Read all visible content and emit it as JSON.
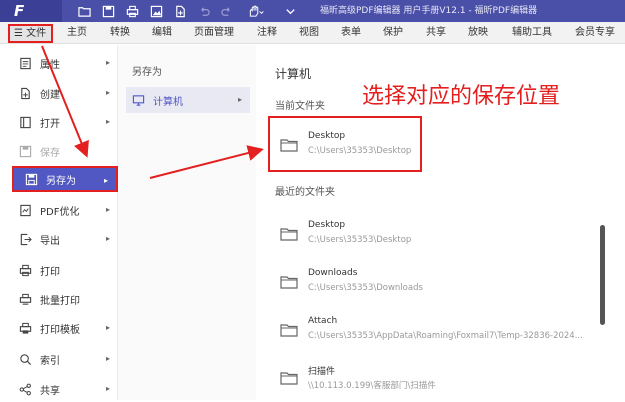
{
  "app": {
    "logo": "F",
    "window_title": "福昕高级PDF编辑器 用户手册V12.1 - 福昕PDF编辑器",
    "brand_color": "#4a4fa8",
    "accent_color": "#5157c3",
    "highlight_color": "#e31f1f"
  },
  "quick_access": [
    "folder-open-icon",
    "save-icon",
    "print-icon",
    "image-icon",
    "new-file-icon",
    "undo-icon",
    "redo-icon",
    "hand-tool-icon",
    "dropdown-icon"
  ],
  "menubar": {
    "file_label": "☰ 文件",
    "items": [
      "主页",
      "转换",
      "编辑",
      "页面管理",
      "注释",
      "视图",
      "表单",
      "保护",
      "共享",
      "放映",
      "辅助工具",
      "会员专享"
    ]
  },
  "left_menu": {
    "items": [
      {
        "label": "属性",
        "icon": "properties-icon",
        "arrow": "▸"
      },
      {
        "label": "创建",
        "icon": "create-icon",
        "arrow": "▸"
      },
      {
        "label": "打开",
        "icon": "open-icon",
        "arrow": "▸"
      },
      {
        "label": "保存",
        "icon": "save-icon",
        "arrow": ""
      },
      {
        "label": "另存为",
        "icon": "save-as-icon",
        "arrow": "▸"
      },
      {
        "label": "PDF优化",
        "icon": "optimize-icon",
        "arrow": "▸"
      },
      {
        "label": "导出",
        "icon": "export-icon",
        "arrow": "▸"
      },
      {
        "label": "打印",
        "icon": "print-icon",
        "arrow": ""
      },
      {
        "label": "批量打印",
        "icon": "batch-print-icon",
        "arrow": ""
      },
      {
        "label": "打印模板",
        "icon": "print-template-icon",
        "arrow": "▸"
      },
      {
        "label": "索引",
        "icon": "index-icon",
        "arrow": "▸"
      },
      {
        "label": "共享",
        "icon": "share-icon",
        "arrow": "▸"
      }
    ]
  },
  "mid_panel": {
    "title": "另存为",
    "item": {
      "label": "计算机",
      "icon": "computer-icon",
      "arrow": "▸"
    }
  },
  "right_panel": {
    "title": "计算机",
    "current_folder_label": "当前文件夹",
    "current_folder": {
      "name": "Desktop",
      "path": "C:\\Users\\35353\\Desktop"
    },
    "recent_label": "最近的文件夹",
    "recent_folders": [
      {
        "name": "Desktop",
        "path": "C:\\Users\\35353\\Desktop"
      },
      {
        "name": "Downloads",
        "path": "C:\\Users\\35353\\Downloads"
      },
      {
        "name": "Attach",
        "path": "C:\\Users\\35353\\AppData\\Roaming\\Foxmail7\\Temp-32836-2024..."
      },
      {
        "name": "扫描件",
        "path": "\\\\10.113.0.199\\客服部门\\扫描件"
      }
    ]
  },
  "annotation": "选择对应的保存位置"
}
